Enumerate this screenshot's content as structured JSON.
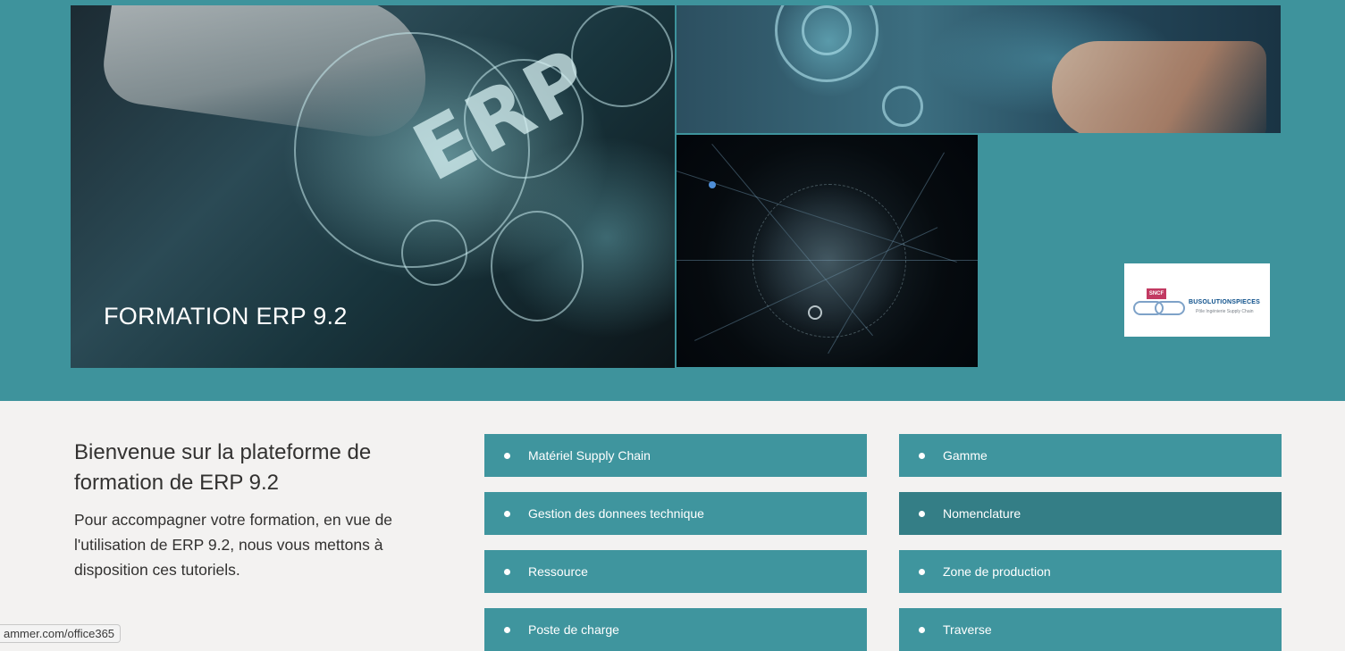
{
  "hero": {
    "title": "FORMATION ERP 9.2",
    "background": "#3e939c",
    "image_text": "ERP",
    "logo": {
      "badge": "SNCF",
      "brand": "BUSOLUTIONSPIECES",
      "tagline": "Pôle Ingénierie Supply Chain"
    }
  },
  "welcome": {
    "heading": "Bienvenue sur la plateforme de formation de ERP 9.2",
    "body": "Pour accompagner votre formation, en vue de l'utilisation de ERP 9.2, nous vous mettons à disposition ces tutoriels."
  },
  "nav": {
    "button_color": "#3f959e",
    "active_color": "#347e86",
    "left": [
      {
        "label": "Matériel Supply Chain"
      },
      {
        "label": "Gestion des donnees technique"
      },
      {
        "label": "Ressource"
      },
      {
        "label": "Poste de charge"
      }
    ],
    "right": [
      {
        "label": "Gamme"
      },
      {
        "label": "Nomenclature"
      },
      {
        "label": "Zone de production"
      },
      {
        "label": "Traverse"
      }
    ]
  },
  "status": {
    "url": "ammer.com/office365"
  }
}
